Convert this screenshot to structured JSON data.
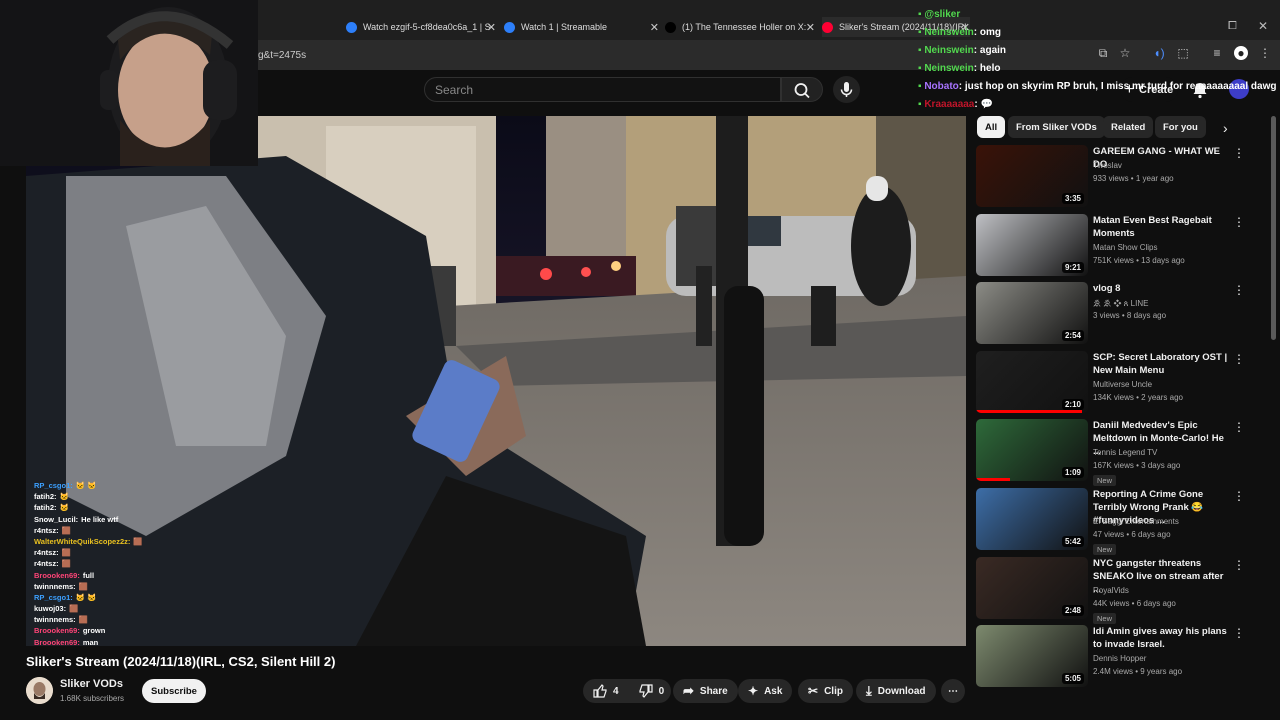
{
  "browser": {
    "tabs": [
      {
        "label": "Watch ezgif-5-cf8dea0c6a_1 | S",
        "color": "#2d7ff9"
      },
      {
        "label": "Watch 1 | Streamable",
        "color": "#2d7ff9"
      },
      {
        "label": "(1) The Tennessee Holler on X:",
        "color": "#000000"
      },
      {
        "label": "Sliker's Stream (2024/11/18)(IRL",
        "color": "#ff0033"
      }
    ],
    "url": "g&t=2475s"
  },
  "header": {
    "search_placeholder": "Search",
    "create_label": "Create"
  },
  "chat_top": [
    {
      "user": "@sliker",
      "text": "",
      "color": "#52d84f"
    },
    {
      "user": "Neinswein",
      "text": ": omg",
      "color": "#52d84f"
    },
    {
      "user": "Neinswein",
      "text": ": again",
      "color": "#52d84f"
    },
    {
      "user": "Neinswein",
      "text": ": helo",
      "color": "#52d84f"
    },
    {
      "user": "Nobato",
      "text": ": just hop on skyrim RP bruh, I miss mr turd for reaaaaaaaaal dawg",
      "color": "#a874ff"
    },
    {
      "user": "Kraaaaaaa",
      "text": ": 💬",
      "color": "#c0152a"
    }
  ],
  "chat_left": [
    {
      "user": "RP_csgo1:",
      "text": "🐱 🐱",
      "color": "#3ca0ff"
    },
    {
      "user": "fatih2:",
      "text": "🐱",
      "color": "#ffffff"
    },
    {
      "user": "fatih2:",
      "text": "🐱",
      "color": "#ffffff"
    },
    {
      "user": "Snow_Lucil:",
      "text": "He like wtf",
      "color": "#ffffff"
    },
    {
      "user": "r4ntsz:",
      "text": "🟫",
      "color": "#ffffff"
    },
    {
      "user": "WalterWhiteQuikScopez2z:",
      "text": "🟫",
      "color": "#e8c020"
    },
    {
      "user": "r4ntsz:",
      "text": "🟫",
      "color": "#ffffff"
    },
    {
      "user": "r4ntsz:",
      "text": "🟫",
      "color": "#ffffff"
    },
    {
      "user": "Broooken69:",
      "text": "full",
      "color": "#ff4477"
    },
    {
      "user": "twinnnems:",
      "text": "🟫",
      "color": "#ffffff"
    },
    {
      "user": "RP_csgo1:",
      "text": "🐱 🐱",
      "color": "#3ca0ff"
    },
    {
      "user": "kuwoj03:",
      "text": "🟫",
      "color": "#ffffff"
    },
    {
      "user": "twinnnems:",
      "text": "🟫",
      "color": "#ffffff"
    },
    {
      "user": "Broooken69:",
      "text": "grown",
      "color": "#ff4477"
    },
    {
      "user": "Broooken69:",
      "text": "man",
      "color": "#ff4477"
    }
  ],
  "video": {
    "title": "Sliker's Stream (2024/11/18)(IRL, CS2, Silent Hill 2)",
    "channel": "Sliker VODs",
    "subscribers": "1.68K subscribers",
    "subscribe_label": "Subscribe",
    "likes": "4",
    "dislikes": "0",
    "share_label": "Share",
    "ask_label": "Ask",
    "clip_label": "Clip",
    "download_label": "Download"
  },
  "sidebar": {
    "chips": [
      "All",
      "From Sliker VODs",
      "Related",
      "For you"
    ],
    "items": [
      {
        "title": "GAREEM GANG - WHAT WE DO",
        "channel": "Twoslav",
        "meta": "933 views • 1 year ago",
        "duration": "3:35",
        "new": "",
        "thumb": "#3a1208",
        "progress": 0
      },
      {
        "title": "Matan Even Best Ragebait Moments",
        "channel": "Matan Show Clips",
        "meta": "751K views • 13 days ago",
        "duration": "9:21",
        "new": "",
        "thumb": "#bfc0c4",
        "progress": 0
      },
      {
        "title": "vlog 8",
        "channel": "ゑ ゑ ❖ ጰ LINE",
        "meta": "3 views • 8 days ago",
        "duration": "2:54",
        "new": "",
        "thumb": "#8c8c86",
        "progress": 0
      },
      {
        "title": "SCP: Secret Laboratory OST | New Main Menu",
        "channel": "Multiverse Uncle",
        "meta": "134K views • 2 years ago",
        "duration": "2:10",
        "new": "",
        "thumb": "#1f1f1f",
        "progress": 0.95
      },
      {
        "title": "Daniil Medvedev's Epic Meltdown in Monte-Carlo! He ...",
        "channel": "Tennis Legend TV",
        "meta": "167K views • 3 days ago",
        "duration": "1:09",
        "new": "New",
        "thumb": "#2e6a3a",
        "progress": 0.3
      },
      {
        "title": "Reporting A Crime Gone Terribly Wrong Prank 😂 #funnyvideos ...",
        "channel": "El Baggi Entertainments",
        "meta": "47 views • 6 days ago",
        "duration": "5:42",
        "new": "New",
        "thumb": "#3d6ea8",
        "progress": 0
      },
      {
        "title": "NYC gangster threatens SNEAKO live on stream after ...",
        "channel": "RoyalVids",
        "meta": "44K views • 6 days ago",
        "duration": "2:48",
        "new": "New",
        "thumb": "#3a2a24",
        "progress": 0
      },
      {
        "title": "Idi Amin gives away his plans to invade Israel.",
        "channel": "Dennis Hopper",
        "meta": "2.4M views • 9 years ago",
        "duration": "5:05",
        "new": "",
        "thumb": "#7d8a6e",
        "progress": 0
      }
    ]
  }
}
